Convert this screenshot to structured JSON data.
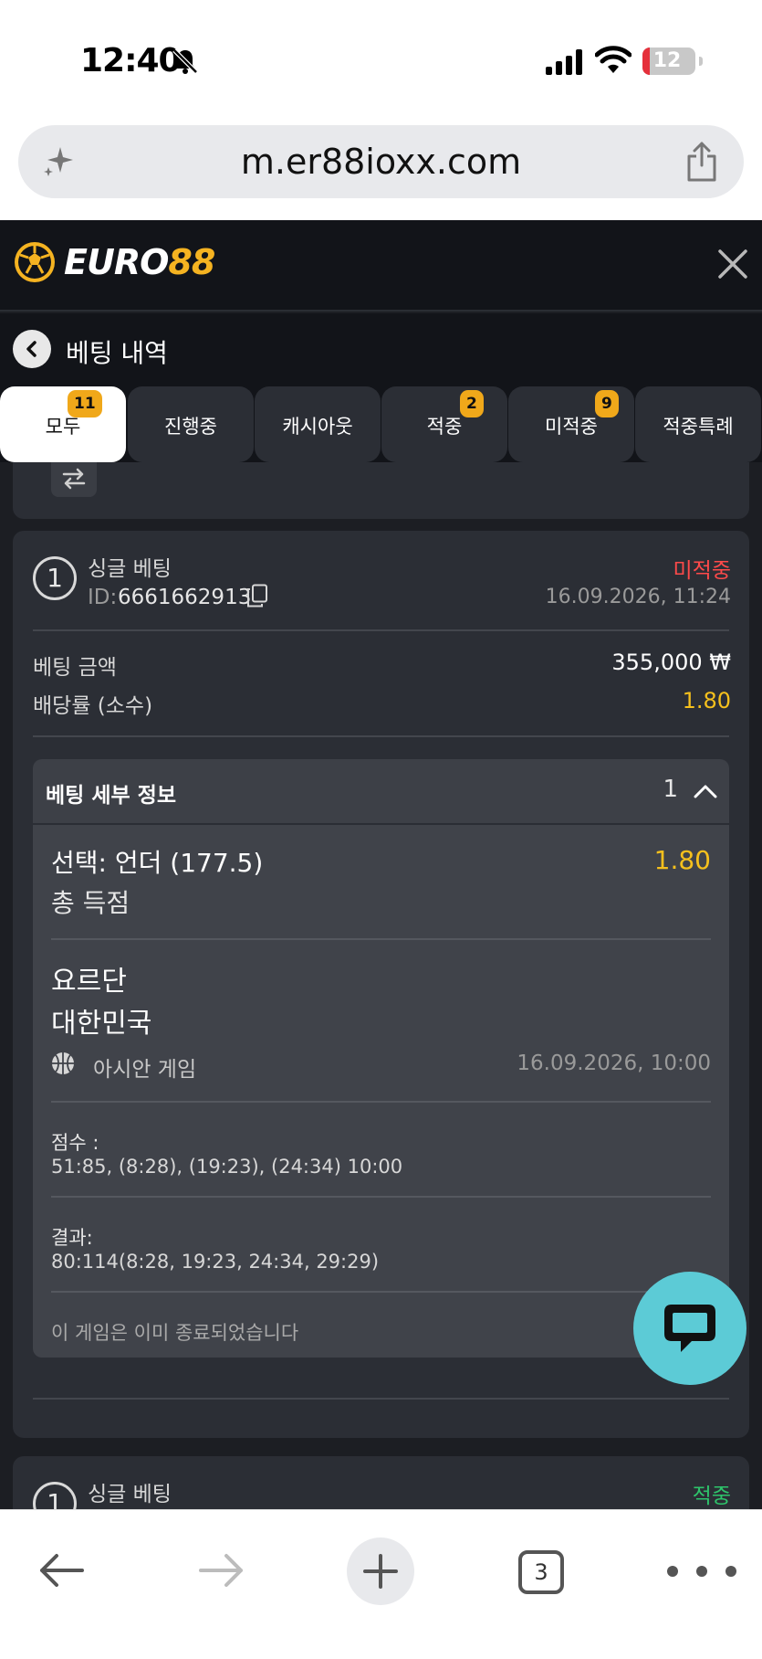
{
  "status_bar": {
    "time": "12:40",
    "battery": "12"
  },
  "browser": {
    "url": "m.er88ioxx.com",
    "tab_count": "3"
  },
  "header": {
    "logo_white": "EURO",
    "logo_yellow": "88"
  },
  "page": {
    "title": "베팅 내역"
  },
  "tabs": [
    {
      "label": "모두",
      "badge": "11",
      "active": true
    },
    {
      "label": "진행중",
      "badge": ""
    },
    {
      "label": "캐시아웃",
      "badge": ""
    },
    {
      "label": "적중",
      "badge": "2"
    },
    {
      "label": "미적중",
      "badge": "9"
    },
    {
      "label": "적중특례",
      "badge": ""
    }
  ],
  "bet": {
    "index": "1",
    "type": "싱글 베팅",
    "id_label": "ID:",
    "id": "6661662913",
    "status": "미적중",
    "date": "16.09.2026, 11:24",
    "amount_label": "베팅 금액",
    "amount": "355,000 ₩",
    "odds_label": "배당률 (소수)",
    "odds": "1.80",
    "details": {
      "title": "베팅 세부 정보",
      "count": "1",
      "selection": "선택: 언더 (177.5)",
      "selection_odds": "1.80",
      "market": "총 득점",
      "team1": "요르단",
      "team2": "대한민국",
      "league": "아시안 게임",
      "match_date": "16.09.2026, 10:00",
      "score_label": "점수 :",
      "score": "51:85, (8:28), (19:23), (24:34) 10:00",
      "result_label": "결과:",
      "result": "80:114(8:28, 19:23, 24:34, 29:29)",
      "ended": "이 게임은 이미 종료되었습니다"
    }
  },
  "next_bet": {
    "index": "1",
    "type": "싱글 베팅",
    "status": "적중"
  }
}
